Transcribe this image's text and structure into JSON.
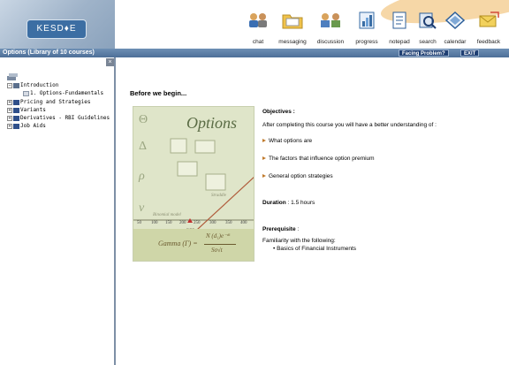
{
  "app": {
    "logo_text": "KESD♦E",
    "course_title": "Options (Library of 10 courses)",
    "facing_problem_label": "Facing Problem?",
    "exit_label": "EXIT"
  },
  "toolbar": [
    {
      "label": "chat",
      "icon": "chat-icon"
    },
    {
      "label": "messaging",
      "icon": "folder-icon"
    },
    {
      "label": "discussion",
      "icon": "discussion-icon"
    },
    {
      "label": "progress",
      "icon": "progress-icon"
    },
    {
      "label": "notepad",
      "icon": "notepad-icon"
    },
    {
      "label": "search",
      "icon": "search-icon"
    },
    {
      "label": "calendar",
      "icon": "calendar-icon"
    },
    {
      "label": "feedback",
      "icon": "feedback-icon"
    }
  ],
  "tree": {
    "close_glyph": "×",
    "items": [
      {
        "label": "Introduction",
        "toggle": "−"
      },
      {
        "label": "1. Options-Fundamentals",
        "toggle": ""
      },
      {
        "label": "Pricing and Strategies",
        "toggle": "+"
      },
      {
        "label": "Variants",
        "toggle": "+"
      },
      {
        "label": "Derivatives - RBI Guidelines",
        "toggle": "+"
      },
      {
        "label": "Job Aids",
        "toggle": "+"
      }
    ]
  },
  "content": {
    "heading": "Before we begin...",
    "objectives_title": "Objectives :",
    "objectives_intro": "After completing this course you will have a better understanding of :",
    "objectives": [
      "What options are",
      "The factors that influence option premium",
      "General option strategies"
    ],
    "duration_label": "Duration",
    "duration_value": ": 1.5 hours",
    "prerequisite_title": "Prerequisite",
    "prerequisite_colon": ":",
    "prerequisite_intro": "Familiarity with the following:",
    "prerequisite_item": "• Basics of Financial Instruments"
  },
  "artwork": {
    "title": "Options",
    "formula_left": "Gamma (Γ) =",
    "formula_num": "N (d₁)e⁻ᵈᵗ",
    "formula_den": "Sσ√t",
    "note_straddle": "Straddle",
    "note_binomial": "Binomial model",
    "note_bs": "Black-Scholes model",
    "bep": "BEP",
    "axis_ticks": [
      "50",
      "100",
      "150",
      "200",
      "250",
      "300",
      "350",
      "400"
    ],
    "greeks": [
      "Θ",
      "Δ",
      "ρ",
      "ν"
    ]
  }
}
